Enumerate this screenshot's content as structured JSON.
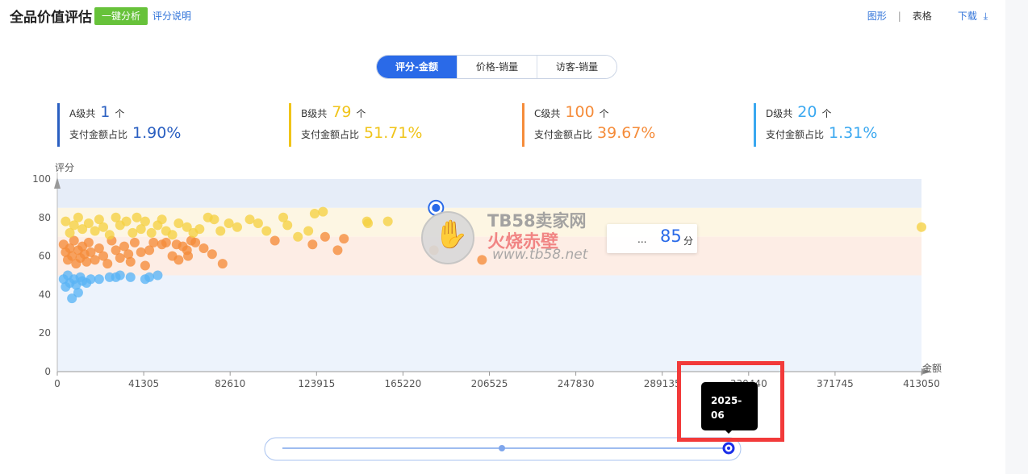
{
  "header": {
    "title": "全品价值评估",
    "analyze_button": "一键分析",
    "explain_link": "评分说明",
    "view_chart": "图形",
    "separator": "|",
    "view_table": "表格",
    "download": "下载",
    "download_icon": "⤓"
  },
  "tabs": [
    {
      "label": "评分-金额",
      "active": true
    },
    {
      "label": "价格-销量",
      "active": false
    },
    {
      "label": "访客-销量",
      "active": false
    }
  ],
  "stats": [
    {
      "grade_label": "A级共",
      "count": "1",
      "unit": "个",
      "share_label": "支付金额占比",
      "share": "1.90%",
      "color": "#2a5fc1"
    },
    {
      "grade_label": "B级共",
      "count": "79",
      "unit": "个",
      "share_label": "支付金额占比",
      "share": "51.71%",
      "color": "#f0c419"
    },
    {
      "grade_label": "C级共",
      "count": "100",
      "unit": "个",
      "share_label": "支付金额占比",
      "share": "39.67%",
      "color": "#f58c3a"
    },
    {
      "grade_label": "D级共",
      "count": "20",
      "unit": "个",
      "share_label": "支付金额占比",
      "share": "1.31%",
      "color": "#3aa8f0"
    }
  ],
  "chart_data": {
    "type": "scatter",
    "ylabel": "评分",
    "xlabel": "金额",
    "xlim": [
      0,
      413050
    ],
    "ylim": [
      0,
      100
    ],
    "x_ticks": [
      "0",
      "41305",
      "82610",
      "123915",
      "165220",
      "206525",
      "247830",
      "289135",
      "330440",
      "371745",
      "413050"
    ],
    "y_ticks": [
      "0",
      "20",
      "40",
      "60",
      "80",
      "100"
    ],
    "bands": [
      {
        "grade": "A",
        "y_from": 85,
        "y_to": 100,
        "color": "#e6edf8"
      },
      {
        "grade": "B",
        "y_from": 70,
        "y_to": 85,
        "color": "#fdf6e3"
      },
      {
        "grade": "C",
        "y_from": 50,
        "y_to": 70,
        "color": "#fdede5"
      },
      {
        "grade": "D",
        "y_from": 0,
        "y_to": 50,
        "color": "#edf3fc"
      }
    ],
    "series": [
      {
        "grade": "A",
        "color": "#2a6ae8",
        "points": [
          [
            181000,
            85
          ]
        ]
      },
      {
        "grade": "B",
        "color": "#f5d142",
        "points": [
          [
            4000,
            78
          ],
          [
            6000,
            72
          ],
          [
            8000,
            76
          ],
          [
            10000,
            80
          ],
          [
            12000,
            74
          ],
          [
            15000,
            77
          ],
          [
            18000,
            73
          ],
          [
            20000,
            79
          ],
          [
            22000,
            75
          ],
          [
            25000,
            71
          ],
          [
            28000,
            80
          ],
          [
            30000,
            76
          ],
          [
            33000,
            78
          ],
          [
            36000,
            72
          ],
          [
            38000,
            80
          ],
          [
            40000,
            74
          ],
          [
            42000,
            78
          ],
          [
            45000,
            72
          ],
          [
            48000,
            76
          ],
          [
            50000,
            79
          ],
          [
            52000,
            73
          ],
          [
            55000,
            71
          ],
          [
            58000,
            77
          ],
          [
            62000,
            75
          ],
          [
            65000,
            72
          ],
          [
            68000,
            74
          ],
          [
            72000,
            80
          ],
          [
            75000,
            79
          ],
          [
            78000,
            73
          ],
          [
            82000,
            77
          ],
          [
            86000,
            75
          ],
          [
            92000,
            79
          ],
          [
            96000,
            77
          ],
          [
            100000,
            73
          ],
          [
            108000,
            80
          ],
          [
            110000,
            76
          ],
          [
            115000,
            70
          ],
          [
            120000,
            73
          ],
          [
            123000,
            82
          ],
          [
            127000,
            83
          ],
          [
            148000,
            78
          ],
          [
            148500,
            77
          ],
          [
            158000,
            78
          ],
          [
            413050,
            75
          ]
        ]
      },
      {
        "grade": "C",
        "color": "#f58c3a",
        "points": [
          [
            3000,
            66
          ],
          [
            4000,
            62
          ],
          [
            5000,
            58
          ],
          [
            6000,
            64
          ],
          [
            7000,
            60
          ],
          [
            8000,
            68
          ],
          [
            9000,
            56
          ],
          [
            10000,
            63
          ],
          [
            11000,
            59
          ],
          [
            12000,
            65
          ],
          [
            13000,
            61
          ],
          [
            14000,
            57
          ],
          [
            15000,
            67
          ],
          [
            16000,
            62
          ],
          [
            18000,
            58
          ],
          [
            20000,
            64
          ],
          [
            22000,
            60
          ],
          [
            24000,
            56
          ],
          [
            26000,
            68
          ],
          [
            28000,
            63
          ],
          [
            30000,
            59
          ],
          [
            32000,
            65
          ],
          [
            34000,
            61
          ],
          [
            35000,
            57
          ],
          [
            37000,
            67
          ],
          [
            40000,
            62
          ],
          [
            42000,
            55
          ],
          [
            44000,
            63
          ],
          [
            46000,
            67
          ],
          [
            50000,
            66
          ],
          [
            52000,
            67
          ],
          [
            55000,
            60
          ],
          [
            57000,
            66
          ],
          [
            58000,
            58
          ],
          [
            60000,
            65
          ],
          [
            62000,
            63
          ],
          [
            62500,
            60
          ],
          [
            64000,
            68
          ],
          [
            66000,
            67
          ],
          [
            70000,
            64
          ],
          [
            74000,
            61
          ],
          [
            79000,
            56
          ],
          [
            104000,
            68
          ],
          [
            122000,
            66
          ],
          [
            128000,
            70
          ],
          [
            134000,
            63
          ],
          [
            137000,
            69
          ],
          [
            180000,
            63
          ],
          [
            203000,
            58
          ]
        ]
      },
      {
        "grade": "D",
        "color": "#5ab4f5",
        "points": [
          [
            3000,
            48
          ],
          [
            4000,
            44
          ],
          [
            5000,
            50
          ],
          [
            6000,
            46
          ],
          [
            7000,
            38
          ],
          [
            8000,
            48
          ],
          [
            9000,
            45
          ],
          [
            10000,
            41
          ],
          [
            11000,
            49
          ],
          [
            12000,
            47
          ],
          [
            14000,
            46
          ],
          [
            16000,
            48
          ],
          [
            20000,
            48
          ],
          [
            25000,
            49
          ],
          [
            28000,
            49
          ],
          [
            30000,
            50
          ],
          [
            35000,
            49
          ],
          [
            42000,
            48
          ],
          [
            44000,
            49
          ],
          [
            48000,
            50
          ]
        ]
      }
    ]
  },
  "tooltip": {
    "dots": "...",
    "value": "85",
    "unit": "分"
  },
  "watermark": {
    "line1": "TB58卖家网",
    "line2": "火烧赤壁",
    "line3": "www.tb58.net",
    "logo_icon": "hand-icon",
    "hand": "✋"
  },
  "timeline": {
    "date_tooltip_line1": "2025-",
    "date_tooltip_line2": "06"
  }
}
